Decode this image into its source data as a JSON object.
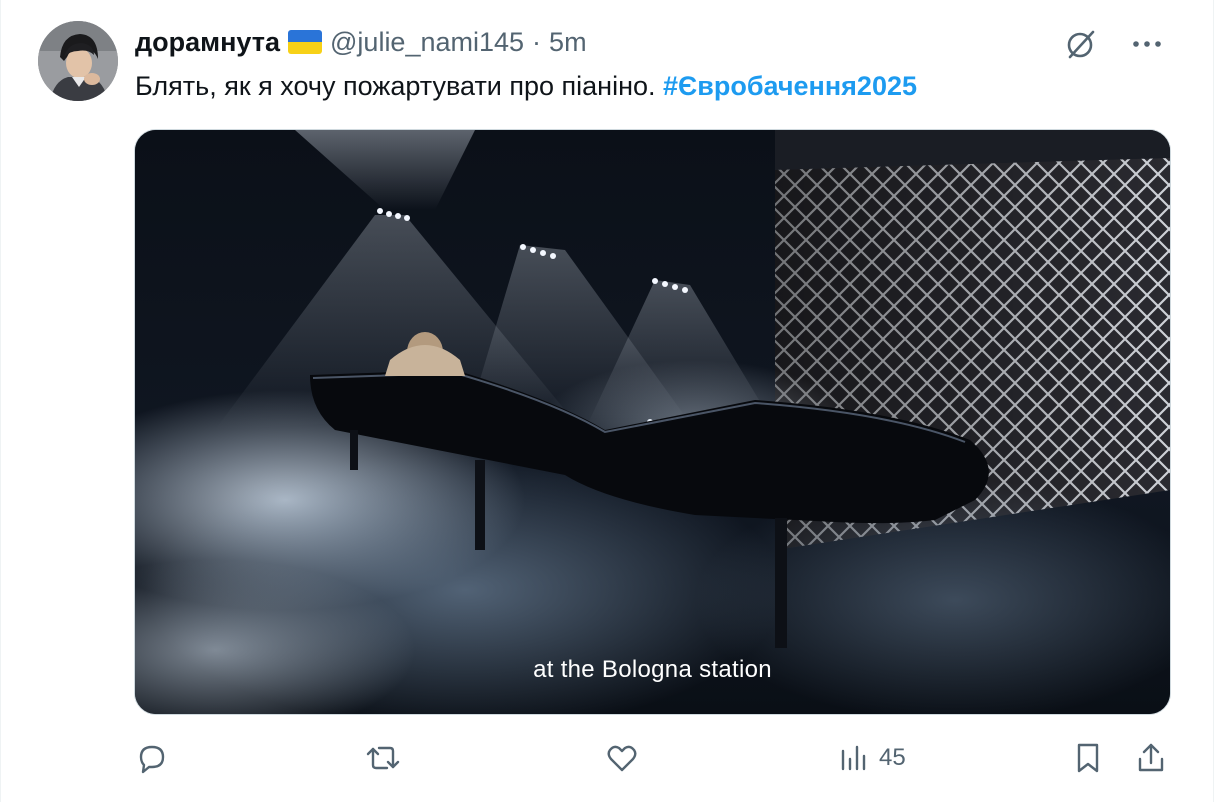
{
  "author": {
    "name": "дорамнута",
    "flag_icon": "ukraine-flag-icon",
    "handle": "@julie_nami145",
    "separator": "·",
    "time": "5m"
  },
  "tweet": {
    "text": "Блять, як я хочу пожартувати про піаніно.",
    "hashtag": "#Євробачення2025"
  },
  "media": {
    "caption": "at the Bologna station"
  },
  "actions": {
    "views_count": "45"
  },
  "icons": {
    "grok": "grok-icon",
    "more": "more-icon",
    "reply": "reply-icon",
    "retweet": "retweet-icon",
    "like": "like-icon",
    "views": "views-icon",
    "bookmark": "bookmark-icon",
    "share": "share-icon"
  },
  "colors": {
    "accent": "#1d9bf0",
    "secondary_text": "#536471",
    "primary_text": "#0f1419"
  }
}
